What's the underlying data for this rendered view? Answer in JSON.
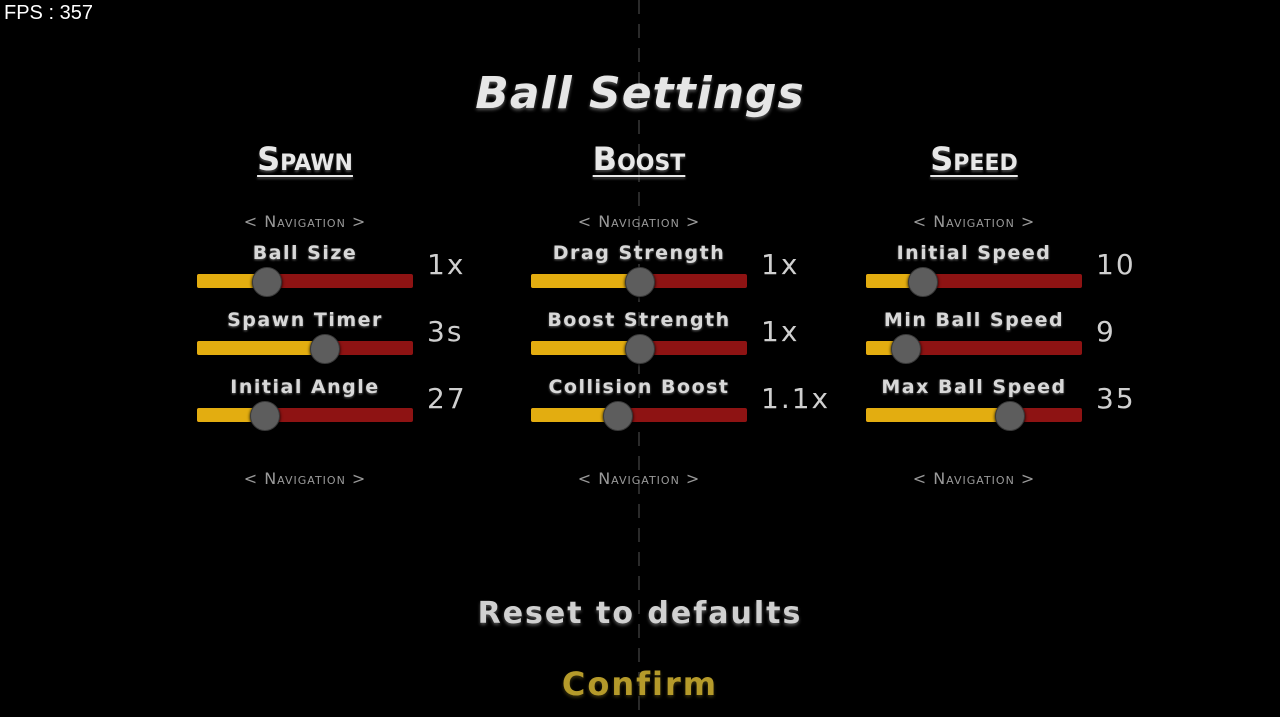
{
  "fps": "FPS : 357",
  "title": "Ball Settings",
  "colors": {
    "slider_fill": "#e3ad10",
    "slider_track": "#8e1313",
    "knob": "#5d5d5d",
    "confirm": "#b59a2a"
  },
  "columns": [
    {
      "title": "Spawn",
      "nav_top": "< Navigation >",
      "nav_bottom": "< Navigation >",
      "settings": [
        {
          "label": "Ball Size",
          "value": "1x",
          "level": 0.32
        },
        {
          "label": "Spawn Timer",
          "value": "3s",
          "level": 0.59
        },
        {
          "label": "Initial Angle",
          "value": "27",
          "level": 0.31
        }
      ]
    },
    {
      "title": "Boost",
      "nav_top": "< Navigation >",
      "nav_bottom": "< Navigation >",
      "settings": [
        {
          "label": "Drag Strength",
          "value": "1x",
          "level": 0.5
        },
        {
          "label": "Boost Strength",
          "value": "1x",
          "level": 0.5
        },
        {
          "label": "Collision Boost",
          "value": "1.1x",
          "level": 0.4
        }
      ]
    },
    {
      "title": "Speed",
      "nav_top": "< Navigation >",
      "nav_bottom": "< Navigation >",
      "settings": [
        {
          "label": "Initial Speed",
          "value": "10",
          "level": 0.26
        },
        {
          "label": "Min Ball Speed",
          "value": "9",
          "level": 0.18
        },
        {
          "label": "Max Ball Speed",
          "value": "35",
          "level": 0.66
        }
      ]
    }
  ],
  "reset_label": "Reset to defaults",
  "confirm_label": "Confirm"
}
